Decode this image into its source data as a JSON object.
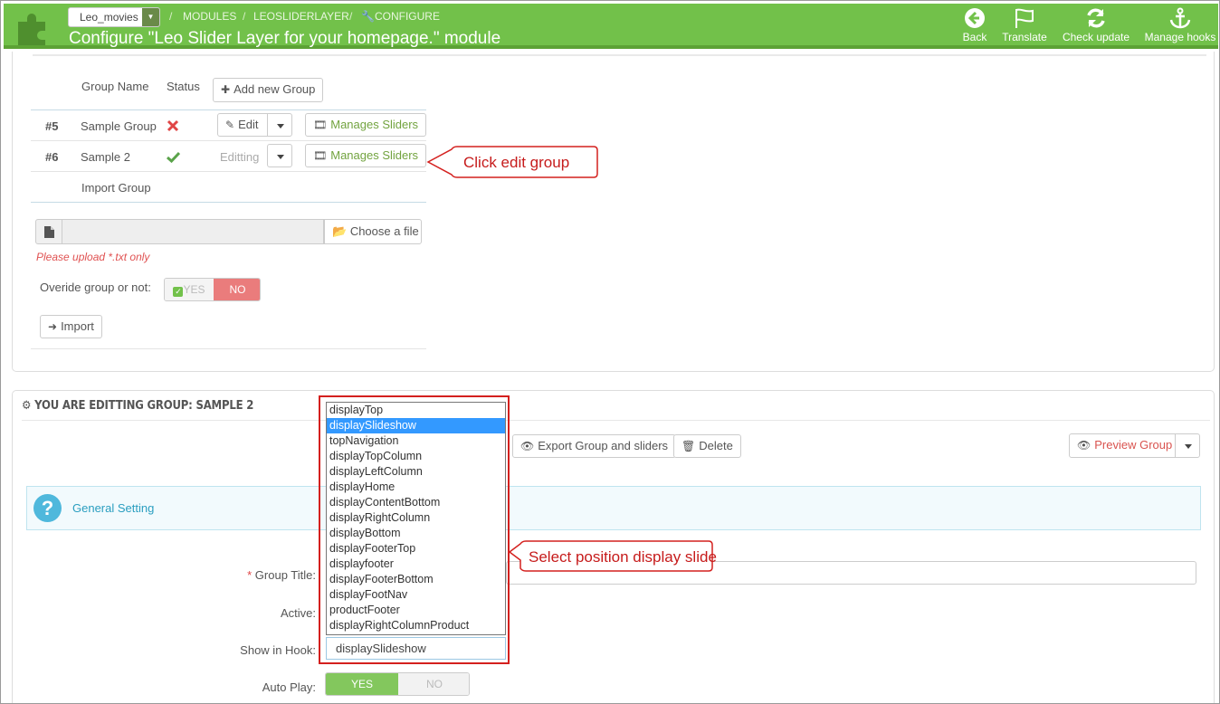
{
  "header": {
    "shop_selector": "Leo_movies",
    "breadcrumb": [
      "MODULES",
      "LEOSLIDERLAYER",
      "CONFIGURE"
    ],
    "title": "Configure \"Leo Slider Layer for your homepage.\" module",
    "toolbar": [
      {
        "label": "Back",
        "icon": "arrow-left-circle-icon"
      },
      {
        "label": "Translate",
        "icon": "flag-icon"
      },
      {
        "label": "Check update",
        "icon": "refresh-icon"
      },
      {
        "label": "Manage hooks",
        "icon": "anchor-icon"
      }
    ]
  },
  "groups_table": {
    "col_group_name": "Group Name",
    "col_status": "Status",
    "add_button": "Add new Group",
    "rows": [
      {
        "id": "#5",
        "name": "Sample Group",
        "status": "disabled",
        "action": "Edit",
        "manage": "Manages Sliders"
      },
      {
        "id": "#6",
        "name": "Sample 2",
        "status": "enabled",
        "action": "Editting",
        "manage": "Manages Sliders"
      }
    ],
    "import_label": "Import Group"
  },
  "import": {
    "choose_file": "Choose a file",
    "hint": "Please upload *.txt only",
    "override_label": "Overide group or not:",
    "yes": "YES",
    "no": "NO",
    "import_button": "Import"
  },
  "editing": {
    "heading": "YOU ARE EDITTING GROUP: SAMPLE 2",
    "export_button": "Export Group and sliders",
    "delete_button": "Delete",
    "preview_button": "Preview Group",
    "general_setting": "General Setting",
    "group_title_label": "Group Title:",
    "active_label": "Active:",
    "show_in_hook_label": "Show in Hook:",
    "show_in_hook_value": "displaySlideshow",
    "auto_play_label": "Auto Play:",
    "auto_play_yes": "YES",
    "auto_play_no": "NO"
  },
  "hook_options": [
    "displayTop",
    "displaySlideshow",
    "topNavigation",
    "displayTopColumn",
    "displayLeftColumn",
    "displayHome",
    "displayContentBottom",
    "displayRightColumn",
    "displayBottom",
    "displayFooterTop",
    "displayfooter",
    "displayFooterBottom",
    "displayFootNav",
    "productFooter",
    "displayRightColumnProduct"
  ],
  "selected_hook_index": 1,
  "annotations": {
    "click_edit": "Click edit group",
    "select_position": "Select position display slide"
  },
  "colors": {
    "header_green": "#72c14a",
    "annotation_red": "#d4201e",
    "link_green": "#72a33f",
    "info_blue": "#4fb8dc"
  }
}
